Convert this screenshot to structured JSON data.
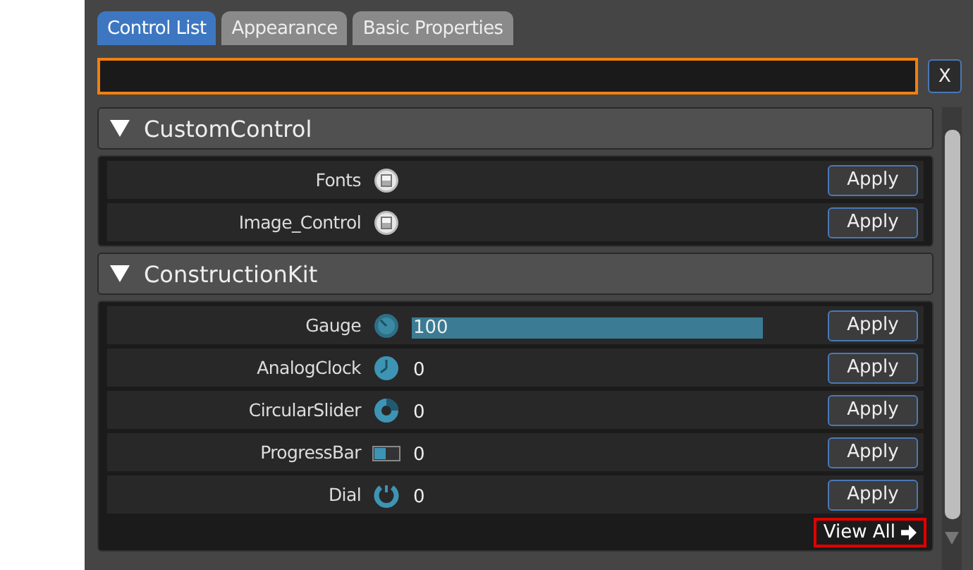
{
  "tabs": [
    {
      "label": "Control List",
      "selected": true
    },
    {
      "label": "Appearance",
      "selected": false
    },
    {
      "label": "Basic Properties",
      "selected": false
    }
  ],
  "search": {
    "clear_button": "X",
    "focused": true
  },
  "groups": [
    {
      "title": "CustomControl",
      "expanded": true,
      "items": [
        {
          "name": "Fonts",
          "kind": "plugin",
          "button": "Apply"
        },
        {
          "name": "Image_Control",
          "kind": "plugin",
          "button": "Apply"
        }
      ]
    },
    {
      "title": "ConstructionKit",
      "expanded": true,
      "items": [
        {
          "name": "Gauge",
          "kind": "gauge",
          "value": "100",
          "value_selected": true,
          "button": "Apply"
        },
        {
          "name": "AnalogClock",
          "kind": "clock",
          "value": "0",
          "value_selected": false,
          "button": "Apply"
        },
        {
          "name": "CircularSlider",
          "kind": "ring",
          "value": "0",
          "value_selected": false,
          "button": "Apply"
        },
        {
          "name": "ProgressBar",
          "kind": "progress",
          "value": "0",
          "value_selected": false,
          "button": "Apply"
        },
        {
          "name": "Dial",
          "kind": "dial",
          "value": "0",
          "value_selected": false,
          "button": "Apply"
        }
      ],
      "footer_link": {
        "label": "View All",
        "outlined": true
      }
    }
  ]
}
